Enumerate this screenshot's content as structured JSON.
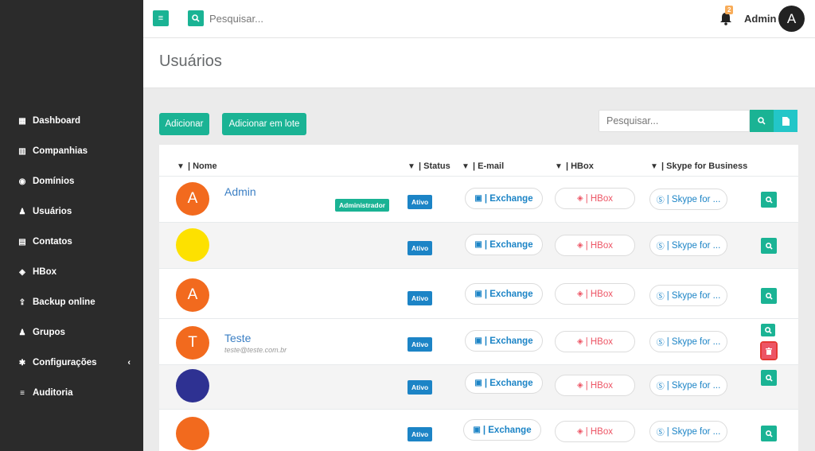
{
  "sidebar": {
    "items": [
      {
        "label": "Dashboard",
        "icon": "▦"
      },
      {
        "label": "Companhias",
        "icon": "▥"
      },
      {
        "label": "Domínios",
        "icon": "◉"
      },
      {
        "label": "Usuários",
        "icon": "♟"
      },
      {
        "label": "Contatos",
        "icon": "▤"
      },
      {
        "label": "HBox",
        "icon": "◈"
      },
      {
        "label": "Backup online",
        "icon": "⇪"
      },
      {
        "label": "Grupos",
        "icon": "♟"
      },
      {
        "label": "Configurações",
        "icon": "✱",
        "chevron": "‹"
      },
      {
        "label": "Auditoria",
        "icon": "≡"
      }
    ]
  },
  "topbar": {
    "menu_icon": "≡",
    "search_placeholder": "Pesquisar...",
    "notification_count": "2",
    "user_name": "Admin",
    "user_initial": "A"
  },
  "page": {
    "title": "Usuários"
  },
  "actions": {
    "add_label": "Adicionar",
    "bulk_add_label": "Adicionar em lote",
    "search_placeholder": "Pesquisar..."
  },
  "table": {
    "headers": {
      "name": "Nome",
      "status": "Status",
      "email": "E-mail",
      "hbox": "HBox",
      "skype": "Skype for Business"
    },
    "pills": {
      "exchange": "| Exchange",
      "hbox": "| HBox",
      "skype": "| Skype for ..."
    },
    "rows": [
      {
        "initial": "A",
        "color": "#f26a1e",
        "name": "Admin",
        "email": "",
        "badge": "Administrador",
        "status": "Ativo"
      },
      {
        "initial": "",
        "color": "#fde100",
        "name": "",
        "email": "",
        "badge": "",
        "status": "Ativo"
      },
      {
        "initial": "A",
        "color": "#f26a1e",
        "name": "",
        "email": "",
        "badge": "",
        "status": "Ativo"
      },
      {
        "initial": "T",
        "color": "#f26a1e",
        "name": "Teste",
        "email": "teste@teste.com.br",
        "badge": "",
        "status": "Ativo"
      },
      {
        "initial": "",
        "color": "#2e3192",
        "name": "",
        "email": "",
        "badge": "",
        "status": "Ativo"
      },
      {
        "initial": "",
        "color": "#f26a1e",
        "name": "",
        "email": "",
        "badge": "",
        "status": "Ativo"
      }
    ]
  },
  "colors": {
    "primary": "#1ab394",
    "info": "#1c84c6",
    "danger": "#ed5565",
    "sidebar": "#2b2b2b"
  }
}
